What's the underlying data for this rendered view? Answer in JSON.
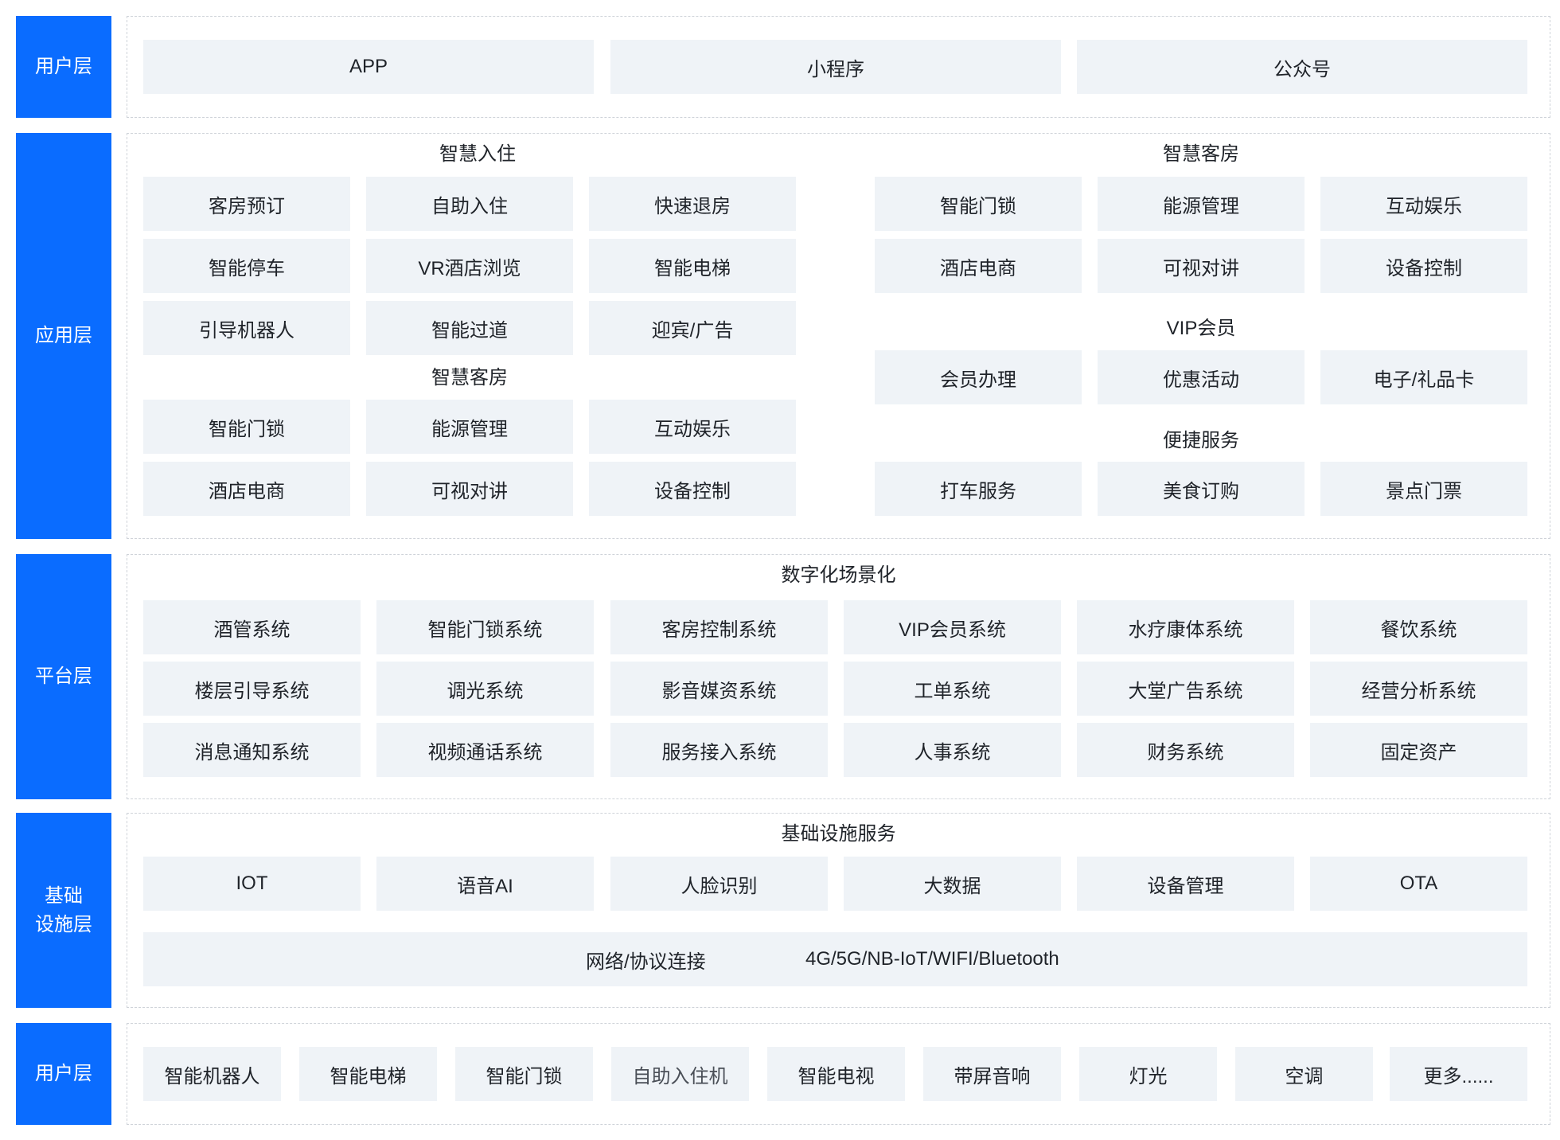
{
  "user_layer": {
    "label": "用户层",
    "items": [
      "APP",
      "小程序",
      "公众号"
    ]
  },
  "app_layer": {
    "label": "应用层",
    "left": {
      "group1": {
        "title": "智慧入住",
        "items": [
          "客房预订",
          "自助入住",
          "快速退房",
          "智能停车",
          "VR酒店浏览",
          "智能电梯",
          "引导机器人",
          "智能过道",
          "迎宾/广告"
        ]
      },
      "group2": {
        "title": "智慧客房",
        "items": [
          "智能门锁",
          "能源管理",
          "互动娱乐",
          "酒店电商",
          "可视对讲",
          "设备控制"
        ]
      }
    },
    "right": {
      "group1": {
        "title": "智慧客房",
        "items": [
          "智能门锁",
          "能源管理",
          "互动娱乐",
          "酒店电商",
          "可视对讲",
          "设备控制"
        ]
      },
      "group2": {
        "title": "VIP会员",
        "items": [
          "会员办理",
          "优惠活动",
          "电子/礼品卡"
        ]
      },
      "group3": {
        "title": "便捷服务",
        "items": [
          "打车服务",
          "美食订购",
          "景点门票"
        ]
      }
    }
  },
  "platform_layer": {
    "label": "平台层",
    "title": "数字化场景化",
    "items": [
      "酒管系统",
      "智能门锁系统",
      "客房控制系统",
      "VIP会员系统",
      "水疗康体系统",
      "餐饮系统",
      "楼层引导系统",
      "调光系统",
      "影音媒资系统",
      "工单系统",
      "大堂广告系统",
      "经营分析系统",
      "消息通知系统",
      "视频通话系统",
      "服务接入系统",
      "人事系统",
      "财务系统",
      "固定资产"
    ]
  },
  "infra_layer": {
    "label": "基础\n设施层",
    "title": "基础设施服务",
    "items": [
      "IOT",
      "语音AI",
      "人脸识别",
      "大数据",
      "设备管理",
      "OTA"
    ],
    "network_label": "网络/协议连接",
    "network_value": "4G/5G/NB-IoT/WIFI/Bluetooth"
  },
  "device_layer": {
    "label": "用户层",
    "items": [
      "智能机器人",
      "智能电梯",
      "智能门锁",
      "自助入住机",
      "智能电视",
      "带屏音响",
      "灯光",
      "空调",
      "更多......"
    ]
  }
}
